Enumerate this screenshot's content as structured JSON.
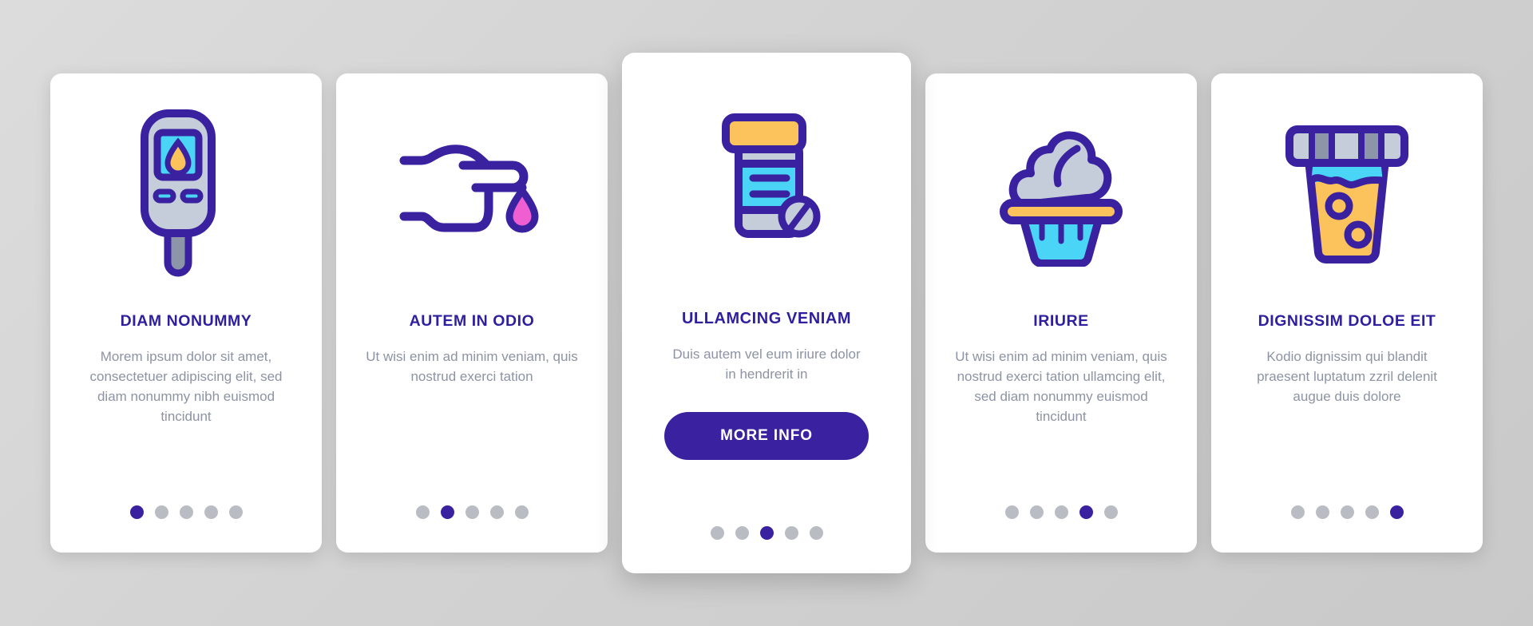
{
  "background_color": "#d4d4d4",
  "theme": {
    "primary": "#3a21a0",
    "title_color": "#2e1f9e",
    "body_text_color": "#8d93a3",
    "card_background": "#ffffff",
    "dot_inactive": "#b9bcc2",
    "dot_active": "#3a21a0",
    "icon_cyan": "#4ad4f5",
    "icon_yellow": "#fcc25c",
    "icon_gray": "#c5cddb",
    "icon_pink": "#ef5fd2",
    "icon_outline": "#3a21a0"
  },
  "cards": [
    {
      "icon_name": "glucose-meter-icon",
      "title": "DIAM NONUMMY",
      "description": "Morem ipsum dolor sit amet, consectetuer adipiscing elit, sed diam nonummy nibh euismod tincidunt",
      "featured": false,
      "cta_label": null,
      "dots": {
        "count": 5,
        "active_index": 0
      }
    },
    {
      "icon_name": "hand-blood-drop-icon",
      "title": "AUTEM IN ODIO",
      "description": "Ut wisi enim ad minim veniam, quis nostrud exerci tation",
      "featured": false,
      "cta_label": null,
      "dots": {
        "count": 5,
        "active_index": 1
      }
    },
    {
      "icon_name": "pill-bottle-icon",
      "title": "ULLAMCING VENIAM",
      "description": "Duis autem vel eum iriure dolor in hendrerit in",
      "featured": true,
      "cta_label": "MORE INFO",
      "dots": {
        "count": 5,
        "active_index": 2
      }
    },
    {
      "icon_name": "cupcake-icon",
      "title": "IRIURE",
      "description": "Ut wisi enim ad minim veniam, quis nostrud exerci tation ullamcing elit, sed diam nonummy euismod tincidunt",
      "featured": false,
      "cta_label": null,
      "dots": {
        "count": 5,
        "active_index": 3
      }
    },
    {
      "icon_name": "urine-sample-cup-icon",
      "title": "DIGNISSIM DOLOE EIT",
      "description": "Kodio dignissim qui blandit praesent luptatum zzril delenit augue duis dolore",
      "featured": false,
      "cta_label": null,
      "dots": {
        "count": 5,
        "active_index": 4
      }
    }
  ]
}
